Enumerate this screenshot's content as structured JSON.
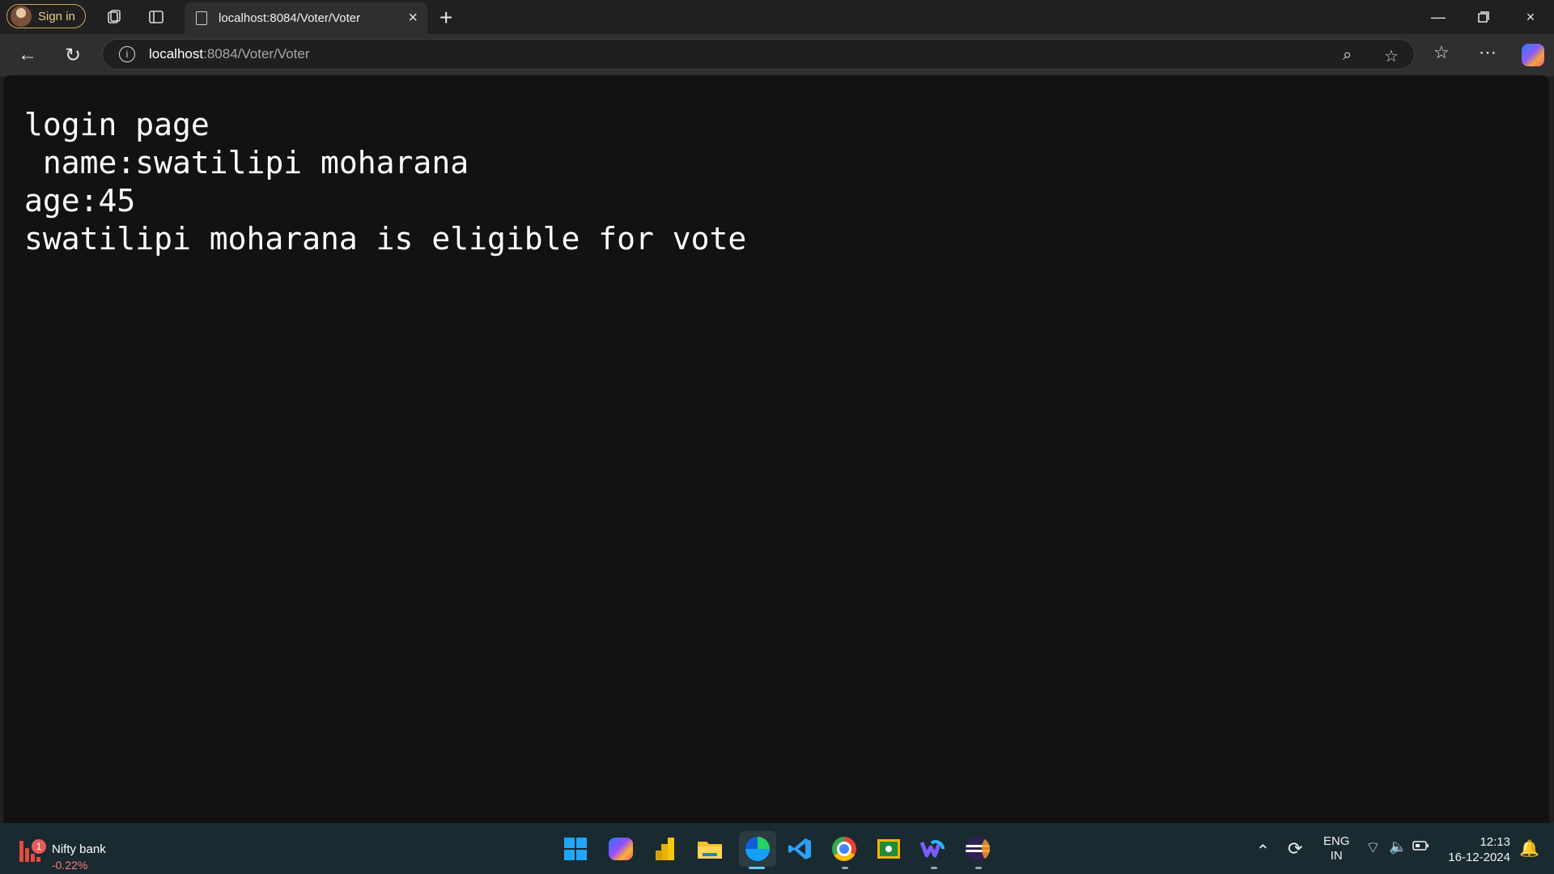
{
  "browser": {
    "signin_label": "Sign in",
    "tab_title": "localhost:8084/Voter/Voter",
    "address_host": "localhost",
    "address_path": ":8084/Voter/Voter"
  },
  "page": {
    "line1": "login page",
    "line2": " name:swatilipi moharana",
    "line3": "age:45",
    "line4": "swatilipi moharana is eligible for vote"
  },
  "taskbar": {
    "widget_title": "Nifty bank",
    "widget_change": "-0.22%",
    "widget_badge": "1",
    "language_top": "ENG",
    "language_bottom": "IN",
    "time": "12:13",
    "date": "16-12-2024"
  },
  "colors": {
    "browser_bg": "#202020",
    "content_bg": "#121212",
    "taskbar_bg": "#1a2a31",
    "accent_signin": "#d8a35a",
    "negative": "#ff7b7b"
  },
  "icons": [
    "profile-avatar-icon",
    "workspaces-icon",
    "vertical-tabs-icon",
    "page-icon",
    "close-icon",
    "new-tab-icon",
    "minimize-icon",
    "restore-icon",
    "back-icon",
    "refresh-icon",
    "site-info-icon",
    "zoom-icon",
    "favorite-star-icon",
    "favorites-list-icon",
    "more-icon",
    "copilot-icon",
    "windows-start-icon",
    "copilot-app-icon",
    "power-bi-icon",
    "file-explorer-icon",
    "edge-icon",
    "vscode-icon",
    "chrome-icon",
    "classroom-icon",
    "webex-icon",
    "eclipse-icon",
    "chevron-up-icon",
    "sync-icon",
    "wifi-icon",
    "volume-icon",
    "battery-icon",
    "notification-bell-icon"
  ]
}
